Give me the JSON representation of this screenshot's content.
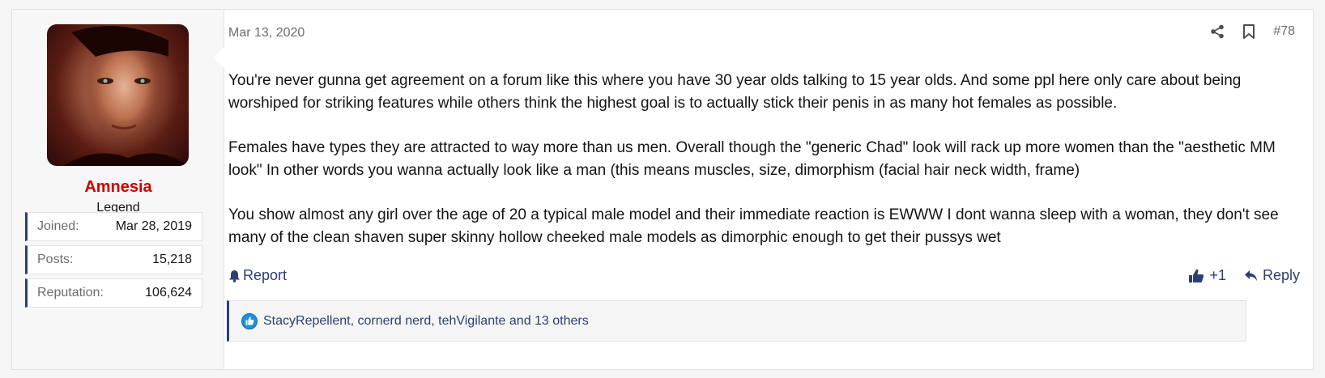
{
  "user": {
    "name": "Amnesia",
    "title": "Legend",
    "stats": [
      {
        "label": "Joined:",
        "value": "Mar 28, 2019"
      },
      {
        "label": "Posts:",
        "value": "15,218"
      },
      {
        "label": "Reputation:",
        "value": "106,624"
      }
    ]
  },
  "post": {
    "date": "Mar 13, 2020",
    "number": "#78",
    "paragraphs": [
      "You're never gunna get agreement on a forum like this where you have 30 year olds talking to 15 year olds. And some ppl here only care about being worshiped for striking features while others think the highest goal is to actually stick their penis in as many hot females as possible.",
      "Females have types they are attracted to way more than us men. Overall though the \"generic Chad\" look will rack up more women than the \"aesthetic MM look\" In other words you wanna actually look like a man (this means muscles, size, dimorphism (facial hair neck width, frame)",
      "You show almost any girl over the age of 20 a typical male model and their immediate reaction is EWWW I dont wanna sleep with a woman, they don't see many of the clean shaven super skinny hollow cheeked male models as dimorphic enough to get their pussys wet"
    ]
  },
  "actions": {
    "report": "Report",
    "like_count": "+1",
    "reply": "Reply"
  },
  "reactions": {
    "text": "StacyRepellent, cornerd nerd, tehVigilante and 13 others"
  },
  "icons": {
    "share": "share-icon",
    "bookmark": "bookmark-icon",
    "bell": "bell-icon",
    "thumbs_up": "thumbs-up-icon",
    "reply": "reply-arrow-icon",
    "like": "like-reaction-icon"
  },
  "colors": {
    "accent": "#2b3f74",
    "username": "#cc0000",
    "like": "#1d8fe0"
  }
}
